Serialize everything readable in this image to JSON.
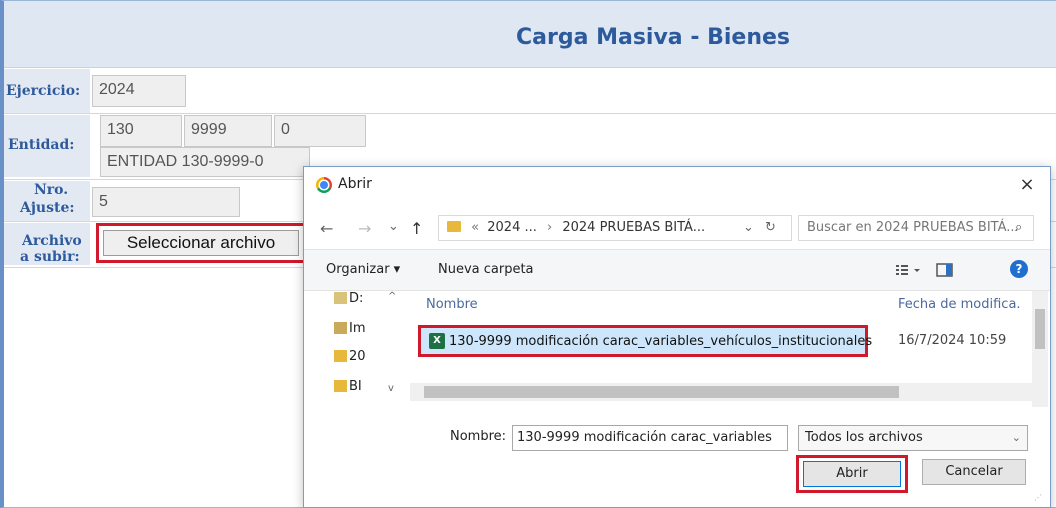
{
  "form": {
    "title": "Carga Masiva - Bienes",
    "ejercicio_label": "Ejercicio:",
    "ejercicio_value": "2024",
    "entidad_label": "Entidad:",
    "entidad_code1": "130",
    "entidad_code2": "9999",
    "entidad_code3": "0",
    "entidad_name": "ENTIDAD 130-9999-0",
    "ajuste_label_1": "Nro.",
    "ajuste_label_2": "Ajuste:",
    "ajuste_value": "5",
    "archivo_label_1": "Archivo",
    "archivo_label_2": "a subir:",
    "select_file_button": "Seleccionar archivo"
  },
  "dialog": {
    "title": "Abrir",
    "close": "×",
    "nav_back": "←",
    "nav_forward": "→",
    "nav_recent": "⌄",
    "nav_up": "↑",
    "address_prefix": "«",
    "address_part1": "2024 ...",
    "address_sep": "›",
    "address_part2": "2024 PRUEBAS BITÁ...",
    "address_dropdown": "⌄",
    "refresh": "↻",
    "search_placeholder": "Buscar en 2024 PRUEBAS BITÁ...",
    "search_icon": "⌕",
    "organize": "Organizar ▾",
    "new_folder": "Nueva carpeta",
    "view_icon": "view-icon",
    "pane_icon": "pane-icon",
    "help_icon": "?",
    "tree": [
      {
        "label": "D:",
        "icon": "document-icon"
      },
      {
        "label": "Im",
        "icon": "image-icon"
      },
      {
        "label": "20",
        "icon": "folder-icon"
      },
      {
        "label": "BI",
        "icon": "folder-icon"
      }
    ],
    "col_name": "Nombre",
    "col_date": "Fecha de modifica.",
    "selected_file": "130-9999 modificación carac_variables_vehículos_institucionales",
    "selected_file_date": "16/7/2024 10:59",
    "name_label": "Nombre:",
    "name_value": "130-9999 modificación carac_variables",
    "file_type": "Todos los archivos",
    "open_button": "Abrir",
    "cancel_button": "Cancelar"
  }
}
